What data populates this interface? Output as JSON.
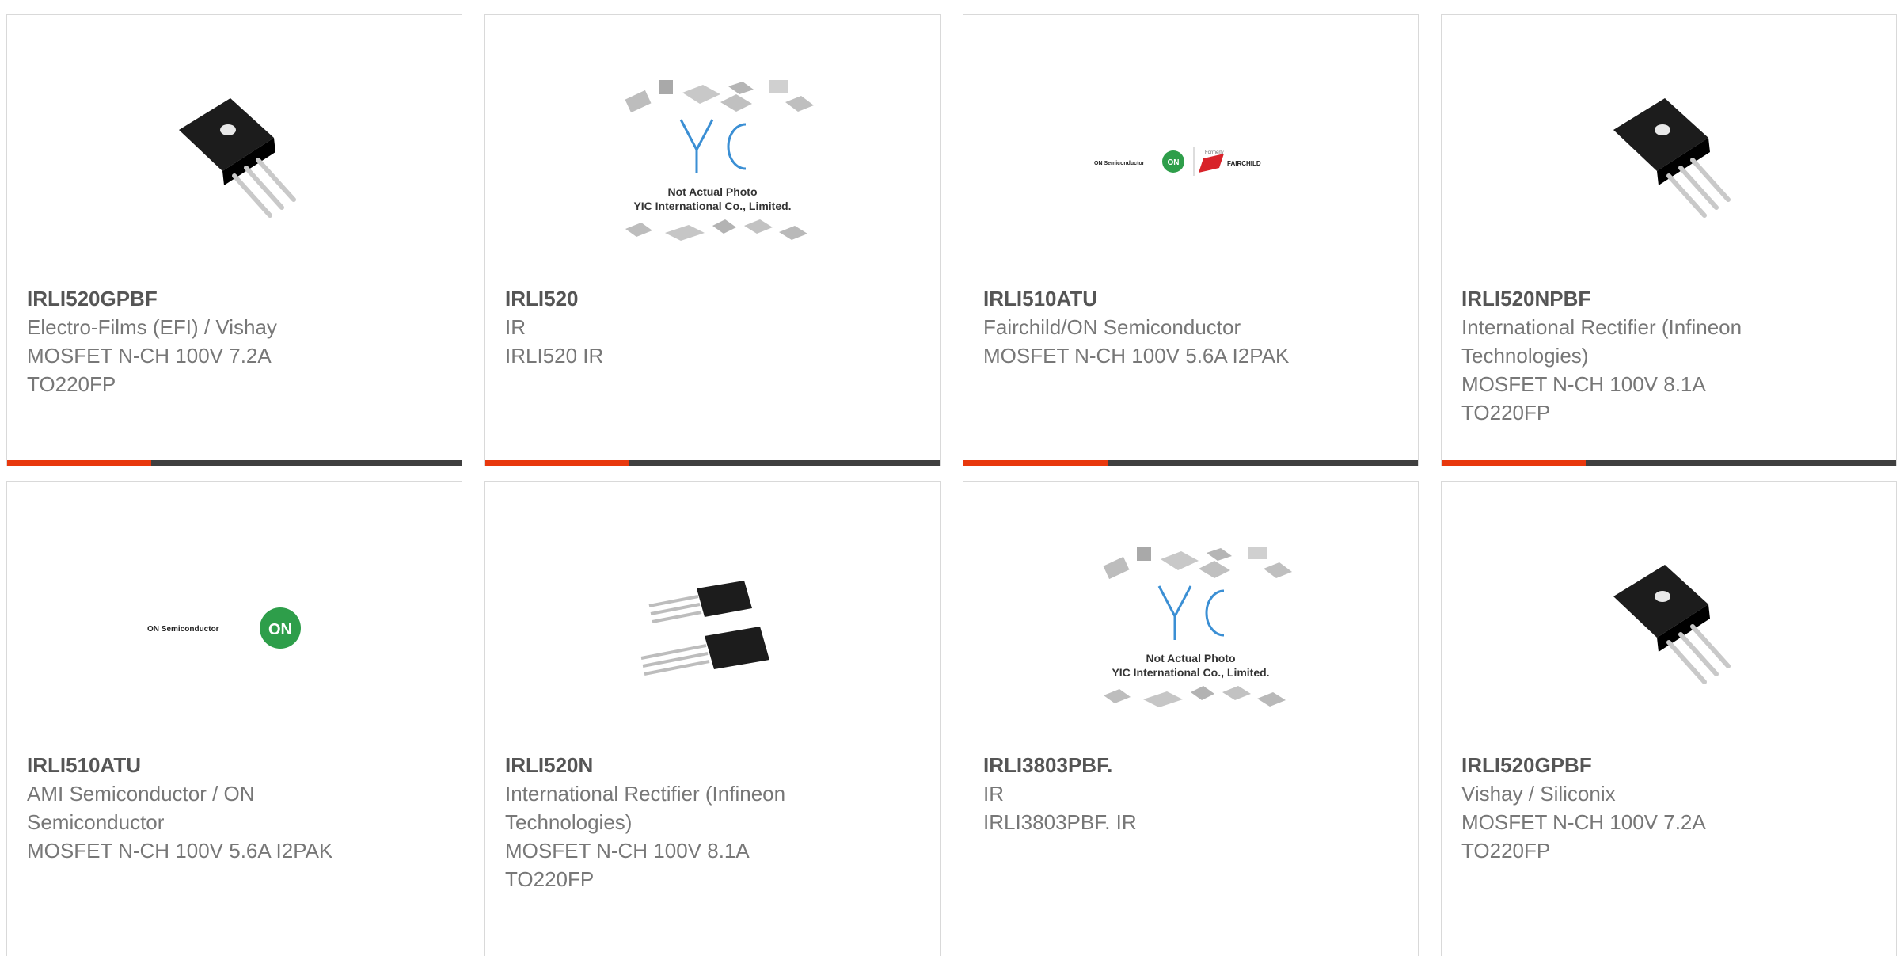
{
  "products": [
    {
      "part": "IRLI520GPBF",
      "lines": [
        "Electro-Films (EFI) / Vishay",
        "MOSFET N-CH 100V 7.2A",
        "TO220FP"
      ],
      "image": "to220fp-icon"
    },
    {
      "part": "IRLI520",
      "lines": [
        "IR",
        "IRLI520 IR"
      ],
      "image": "yic-placeholder-icon"
    },
    {
      "part": "IRLI510ATU",
      "lines": [
        "Fairchild/ON Semiconductor",
        "MOSFET N-CH 100V 5.6A I2PAK"
      ],
      "image": "onsemi-fairchild-logo"
    },
    {
      "part": "IRLI520NPBF",
      "lines": [
        "International Rectifier (Infineon",
        "Technologies)",
        "MOSFET N-CH 100V 8.1A",
        "TO220FP"
      ],
      "image": "to220fp-icon"
    },
    {
      "part": "IRLI510ATU",
      "lines": [
        "AMI Semiconductor / ON",
        "Semiconductor",
        "MOSFET N-CH 100V 5.6A I2PAK"
      ],
      "image": "onsemi-logo"
    },
    {
      "part": "IRLI520N",
      "lines": [
        "International Rectifier (Infineon",
        "Technologies)",
        "MOSFET N-CH 100V 8.1A",
        "TO220FP"
      ],
      "image": "two-transistor-icon"
    },
    {
      "part": "IRLI3803PBF.",
      "lines": [
        "IR",
        "IRLI3803PBF. IR"
      ],
      "image": "yic-placeholder-icon"
    },
    {
      "part": "IRLI520GPBF",
      "lines": [
        "Vishay / Siliconix",
        "MOSFET N-CH 100V 7.2A",
        "TO220FP"
      ],
      "image": "to220fp-icon"
    }
  ],
  "yic_placeholder": {
    "brand": "YIC",
    "caption1": "Not Actual Photo",
    "caption2": "YIC International Co., Limited."
  },
  "logos": {
    "onsemi": "ON Semiconductor",
    "on_badge": "ON",
    "formerly": "Formerly",
    "fairchild": "FAIRCHILD"
  },
  "colors": {
    "accent": "#e8380d",
    "bar": "#3f3f3f",
    "part_text": "#555555",
    "body_text": "#777777",
    "border": "#d9d9d9"
  }
}
